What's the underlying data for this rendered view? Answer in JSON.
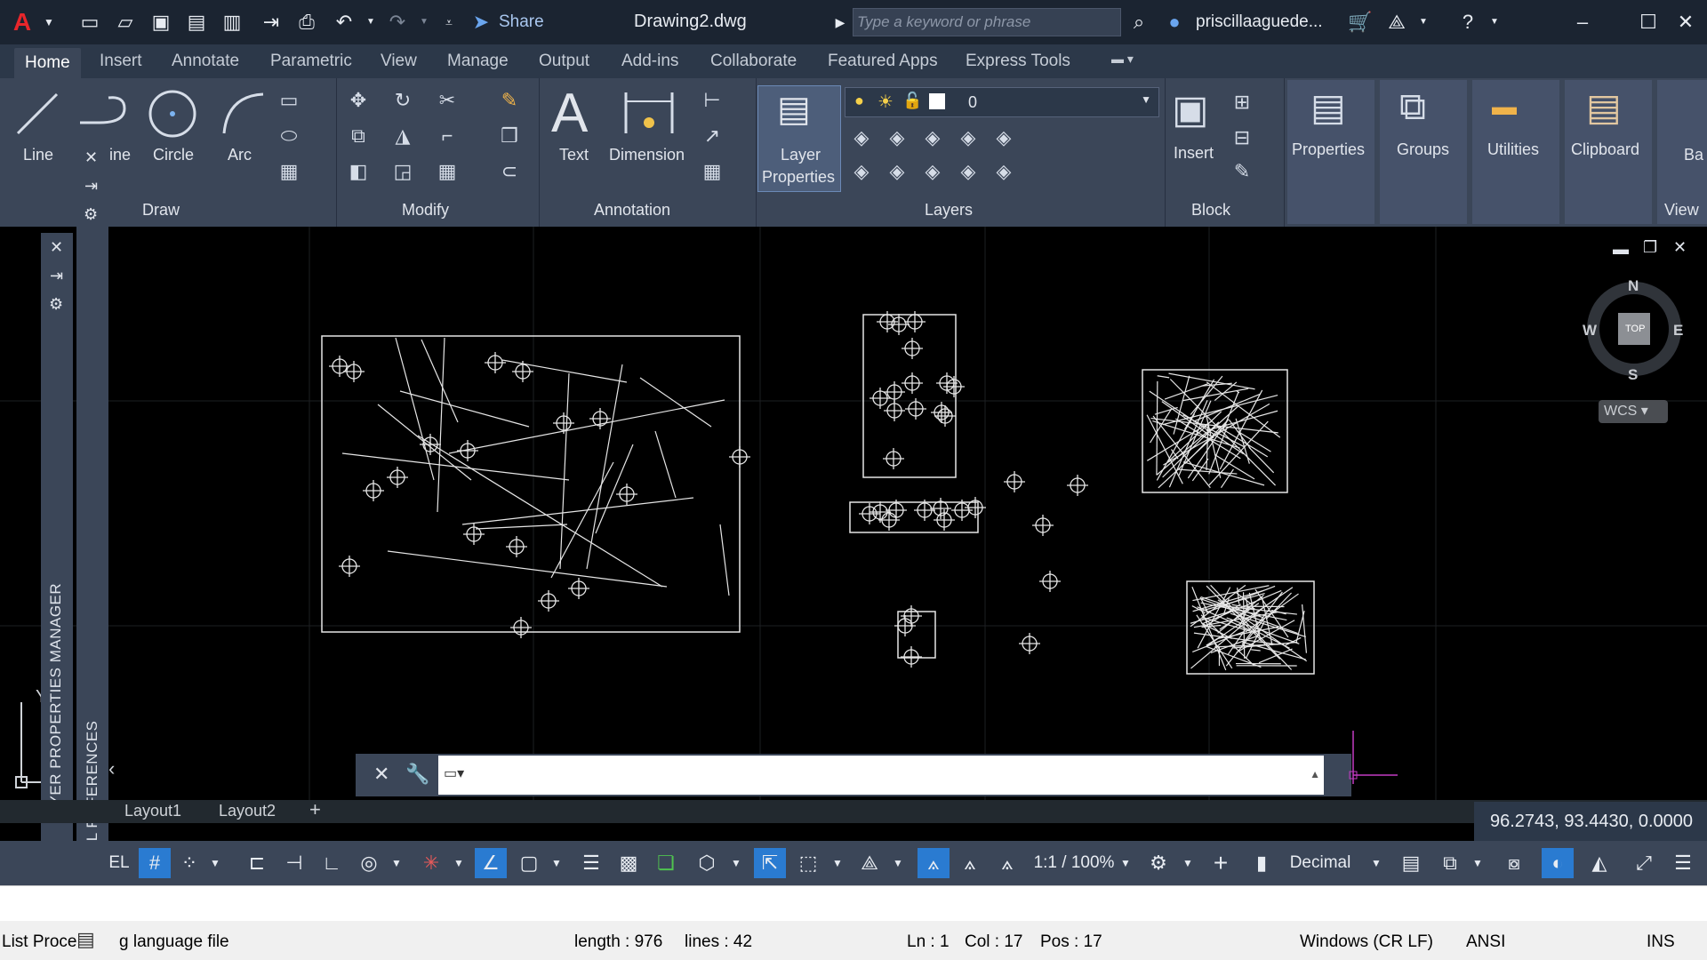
{
  "title_bar": {
    "share_label": "Share",
    "document_title": "Drawing2.dwg",
    "search_placeholder": "Type a keyword or phrase",
    "user_name": "priscillaaguede..."
  },
  "ribbon_tabs": [
    "Home",
    "Insert",
    "Annotate",
    "Parametric",
    "View",
    "Manage",
    "Output",
    "Add-ins",
    "Collaborate",
    "Featured Apps",
    "Express Tools"
  ],
  "ribbon": {
    "draw": {
      "line": "Line",
      "polyline": "ine",
      "circle": "Circle",
      "arc": "Arc",
      "title": "Draw"
    },
    "modify": {
      "title": "Modify"
    },
    "annotation": {
      "text": "Text",
      "dimension": "Dimension",
      "title": "Annotation"
    },
    "layers": {
      "layer_properties_1": "Layer",
      "layer_properties_2": "Properties",
      "current_layer": "0",
      "title": "Layers"
    },
    "block": {
      "insert": "Insert",
      "title": "Block"
    },
    "properties": "Properties",
    "groups": "Groups",
    "utilities": "Utilities",
    "clipboard": "Clipboard",
    "base": "Ba",
    "view": "View"
  },
  "viewcube": {
    "north": "N",
    "south": "S",
    "east": "E",
    "west": "W",
    "face": "TOP",
    "ucs": "WCS"
  },
  "palettes": {
    "layer_manager": "LAYER PROPERTIES MANAGER",
    "external_references": "EXTERNAL REFERENCES"
  },
  "layout_tabs": [
    "Layout1",
    "Layout2"
  ],
  "status": {
    "coordinates": "96.2743, 93.4430, 0.0000",
    "model_fragment": "EL",
    "scale": "1:1 / 100%",
    "units": "Decimal"
  },
  "notepad_status": {
    "left": "List Proce",
    "left2": "g language file",
    "length": "length : 976",
    "lines": "lines : 42",
    "ln": "Ln : 1",
    "col": "Col : 17",
    "pos": "Pos : 17",
    "eol": "Windows (CR LF)",
    "encoding": "ANSI",
    "mode": "INS"
  },
  "colors": {
    "accent": "#2a7bd1",
    "ribbon": "#3b4658",
    "titlebar": "#1b2431",
    "canvas": "#000000"
  }
}
